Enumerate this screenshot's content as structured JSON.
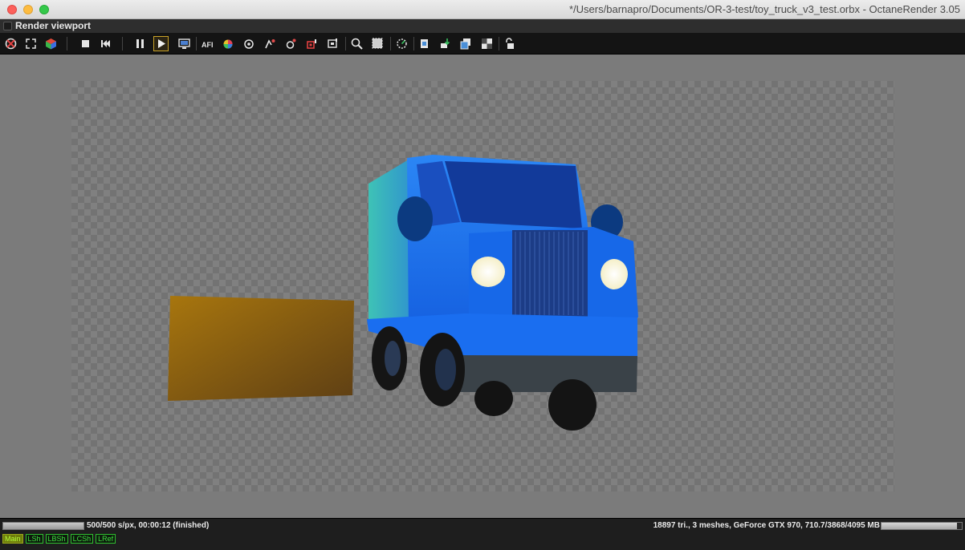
{
  "window": {
    "title": "*/Users/barnapro/Documents/OR-3-test/toy_truck_v3_test.orbx - OctaneRender 3.05"
  },
  "panel": {
    "title": "Render viewport"
  },
  "toolbar": {
    "icons": [
      "reset-camera-icon",
      "fit-view-icon",
      "viewport-cube-icon",
      "stop-icon",
      "restart-icon",
      "pause-icon",
      "start-icon",
      "real-time-icon",
      "aperture-icon",
      "color-picker-icon",
      "focus-picker-icon",
      "white-balance-icon",
      "material-picker-icon",
      "object-picker-icon",
      "camera-target-icon",
      "zoom-icon",
      "region-render-icon",
      "film-region-icon",
      "clay-mode-icon",
      "subsample-icon",
      "decal-icon",
      "lock-icon"
    ],
    "active": "start-icon"
  },
  "render": {
    "description_colors": {
      "truck_cab": "#1a6ef0",
      "truck_box": "#2fb7a8",
      "windshield": "#123a9a",
      "bumper": "#3a4248",
      "box_object": "#9a6a12",
      "headlight": "#fff8d8"
    }
  },
  "status": {
    "progress": 1.0,
    "render_stats": "500/500 s/px, 00:00:12 (finished)",
    "scene_stats": "18897 tri., 3 meshes, GeForce GTX 970, 710.7/3868/4095 MB",
    "vram_fraction": 0.9445
  },
  "passes": [
    {
      "label": "Main",
      "selected": true
    },
    {
      "label": "LSh",
      "selected": false
    },
    {
      "label": "LBSh",
      "selected": false
    },
    {
      "label": "LCSh",
      "selected": false
    },
    {
      "label": "LRef",
      "selected": false
    }
  ]
}
